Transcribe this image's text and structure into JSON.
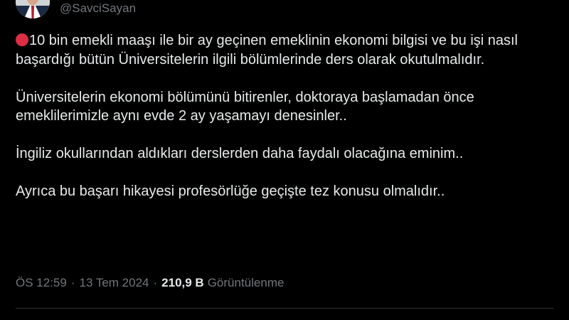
{
  "author": {
    "handle": "@SavciSayan",
    "avatar_icon": "profile-photo-icon"
  },
  "tweet": {
    "lead_icon": "red-circle-emoji-icon",
    "lead_icon_color": "#dd2e44",
    "paragraphs": [
      "10 bin emekli maaşı ile bir ay geçinen emeklinin ekonomi bilgisi ve bu işi nasıl başardığı bütün Üniversitelerin ilgili bölümlerinde ders olarak okutulmalıdır.",
      "Üniversitelerin ekonomi bölümünü bitirenler, doktoraya başlamadan önce emeklilerimizle aynı evde 2 ay yaşamayı denesinler..",
      "İngiliz okullarından aldıkları derslerden daha faydalı olacağına eminim..",
      "Ayrıca bu başarı hikayesi profesörlüğe geçişte tez konusu olmalıdır.."
    ]
  },
  "meta": {
    "time": "ÖS 12:59",
    "separator": "·",
    "date": "13 Tem 2024",
    "views_count": "210,9 B",
    "views_label": "Görüntülenme"
  },
  "colors": {
    "background": "#000000",
    "text_primary": "#e7e9ea",
    "text_secondary": "#71767b",
    "divider": "#2f3336"
  }
}
